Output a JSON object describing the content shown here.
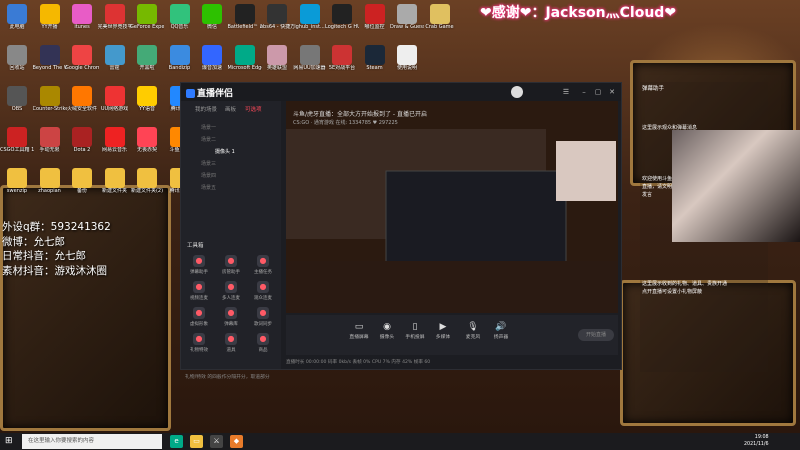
{
  "desktop_icons": [
    {
      "label": "此电脑",
      "icon": "computer-icon",
      "color": "#3a7bd5"
    },
    {
      "label": "YY开播",
      "icon": "yy-icon",
      "color": "#f5b800"
    },
    {
      "label": "itunes",
      "icon": "itunes-icon",
      "color": "#e85cc6"
    },
    {
      "label": "完美世界竞技平台",
      "icon": "perfectworld-icon",
      "color": "#d33"
    },
    {
      "label": "GeForce Experience",
      "icon": "nvidia-icon",
      "color": "#76b900"
    },
    {
      "label": "QQ音乐",
      "icon": "qqmusic-icon",
      "color": "#31c27c"
    },
    {
      "label": "微信",
      "icon": "wechat-icon",
      "color": "#2dc100"
    },
    {
      "label": "Battlefield™ 2042 Ope...",
      "icon": "battlefield-icon",
      "color": "#222"
    },
    {
      "label": "obs64 - 快捷方式",
      "icon": "obs-icon",
      "color": "#333"
    },
    {
      "label": "lghub_inst...",
      "icon": "logitech-icon",
      "color": "#0a9bd7"
    },
    {
      "label": "Logitech G HUB",
      "icon": "ghub-icon",
      "color": "#222"
    },
    {
      "label": "哪位监控",
      "icon": "monitor-icon",
      "color": "#c22"
    },
    {
      "label": "Draw & Guess",
      "icon": "draw-icon",
      "color": "#aaa"
    },
    {
      "label": "Crab Game",
      "icon": "crab-icon",
      "color": "#e0c060"
    },
    {
      "label": "回收站",
      "icon": "recycle-bin-icon",
      "color": "#888"
    },
    {
      "label": "Beyond The Wire Sour...",
      "icon": "beyond-icon",
      "color": "#335"
    },
    {
      "label": "Google Chrome",
      "icon": "chrome-icon",
      "color": "#e44"
    },
    {
      "label": "雷霆",
      "icon": "thunder-icon",
      "color": "#49c"
    },
    {
      "label": "开黑啦",
      "icon": "kaiheila-icon",
      "color": "#4a7"
    },
    {
      "label": "Bandizip",
      "icon": "bandizip-icon",
      "color": "#3b8be0"
    },
    {
      "label": "爆音加速",
      "icon": "speed-icon",
      "color": "#36f"
    },
    {
      "label": "Microsoft Edge",
      "icon": "edge-icon",
      "color": "#0a8"
    },
    {
      "label": "英雄联盟",
      "icon": "lol-icon",
      "color": "#c9a"
    },
    {
      "label": "网易UU加速器",
      "icon": "uu-icon",
      "color": "#777"
    },
    {
      "label": "5E对战平台",
      "icon": "fivee-icon",
      "color": "#c33"
    },
    {
      "label": "Steam",
      "icon": "steam-icon",
      "color": "#1b2838"
    },
    {
      "label": "使用说明",
      "icon": "doc-icon",
      "color": "#eee"
    },
    {
      "label": "OBS",
      "icon": "obs2-icon",
      "color": "#555"
    },
    {
      "label": "Counter-Strike Global Off...",
      "icon": "csgo-icon",
      "color": "#a80"
    },
    {
      "label": "火绒安全软件",
      "icon": "huorong-icon",
      "color": "#f70"
    },
    {
      "label": "UU网络游戏",
      "icon": "uugame-icon",
      "color": "#e33"
    },
    {
      "label": "YY语音",
      "icon": "yyvoice-icon",
      "color": "#fc0"
    },
    {
      "label": "腾讯QQ",
      "icon": "qq-icon",
      "color": "#28f"
    },
    {
      "label": "CSGO工具箱 1.0.3 (1)",
      "icon": "csgotool-icon",
      "color": "#c22"
    },
    {
      "label": "手动无限",
      "icon": "handtool-icon",
      "color": "#c44"
    },
    {
      "label": "Dota 2",
      "icon": "dota-icon",
      "color": "#a22"
    },
    {
      "label": "网易云音乐",
      "icon": "neteasemusic-icon",
      "color": "#e22"
    },
    {
      "label": "无畏赤契",
      "icon": "valorant-icon",
      "color": "#f45"
    },
    {
      "label": "斗鱼直播",
      "icon": "douyu-icon",
      "color": "#f80"
    },
    {
      "label": "swenzip",
      "icon": "zip-icon",
      "color": "#f0c040"
    },
    {
      "label": "zhaopian",
      "icon": "folder-icon",
      "color": "#f0c040"
    },
    {
      "label": "备份",
      "icon": "folder2-icon",
      "color": "#f0c040"
    },
    {
      "label": "新建文件夹",
      "icon": "folder3-icon",
      "color": "#f0c040"
    },
    {
      "label": "新建文件夹(2)",
      "icon": "folder4-icon",
      "color": "#f0c040"
    },
    {
      "label": "腾讯会议",
      "icon": "folder5-icon",
      "color": "#f0c040"
    }
  ],
  "overlay_left": {
    "line1": "外设q群：593241362",
    "line2": "微博：允七郎",
    "line3": "日常抖音：允七郎",
    "line4": "素材抖音：游戏沐沐圈"
  },
  "thanks_banner": "❤感谢❤：Jackson灬Cloud❤",
  "app": {
    "logo": "直播伴侣",
    "left_tabs": [
      "我的场景",
      "画板",
      "可选项"
    ],
    "scenes": [
      "场景一",
      "场景二",
      "摄像头 1",
      "场景三",
      "场景四",
      "场景五"
    ],
    "toolbox_label": "工具箱",
    "tools": [
      "弹幕助手",
      "房管助手",
      "主播任务",
      "视频连麦",
      "多人连麦",
      "观众连麦",
      "虚拟形象",
      "弹幕库",
      "歌词同步",
      "礼物特效",
      "道具",
      "商品"
    ],
    "status_left": "礼物/特效  的四般作分隔开分，取道部分",
    "stream_title": "斗鱼/虎牙直播：全部大方开始报到了 - 直播已开启",
    "stream_meta": "CS:GO · 通宵游戏   在线: 1334785   ♥ 297225",
    "bottom_buttons": [
      "直播屏幕",
      "摄像头",
      "手机投屏",
      "多媒体",
      "麦克风",
      "扬声器"
    ],
    "start_label": "开始直播",
    "stat_bar": "直播时长  00:00:00   码率 0kb/s   丢帧 0%   CPU 7%   内存 42%   帧率 60"
  },
  "right_panel": {
    "title": "弹幕助手",
    "msg1": "这里展示观众和弹幕消息",
    "msg2": "欢迎使用斗鱼直播，请文明发言",
    "msg3": "这里展示收到的礼物、道具、贵族开通",
    "msg4": "点开直播可设置小礼物屏蔽"
  },
  "taskbar": {
    "search_placeholder": "在这里输入你要搜索的内容",
    "time": "19:08",
    "date": "2021/11/6"
  }
}
